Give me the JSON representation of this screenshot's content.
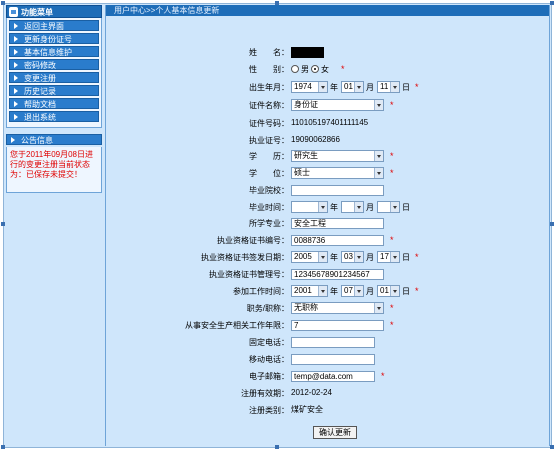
{
  "sidebar": {
    "title": "功能菜单",
    "items": [
      {
        "label": "返回主界面"
      },
      {
        "label": "更新身份证号"
      },
      {
        "label": "基本信息维护"
      },
      {
        "label": "密码修改"
      },
      {
        "label": "变更注册"
      },
      {
        "label": "历史记录"
      },
      {
        "label": "帮助文档"
      },
      {
        "label": "退出系统"
      }
    ],
    "notice_title": "公告信息",
    "notice_text": "您于2011年09月08日进行的变更注册当前状态为：已保存未提交！"
  },
  "main": {
    "breadcrumb": "用户中心>>个人基本信息更新"
  },
  "form": {
    "name_label": "姓　　名：",
    "gender_label": "性　　别：",
    "gender_male": "男",
    "gender_female": "女",
    "birth_label": "出生年月：",
    "birth_year": "1974",
    "birth_month": "01",
    "birth_day": "11",
    "unit_year": "年",
    "unit_month": "月",
    "unit_day": "日",
    "id_type_label": "证件名称：",
    "id_type_value": "身份证",
    "id_number_label": "证件号码：",
    "id_number_value": "110105197401111145",
    "license_label": "执业证号：",
    "license_value": "19090062866",
    "education_label": "学　　历：",
    "education_value": "研究生",
    "degree_label": "学　　位：",
    "degree_value": "硕士",
    "school_label": "毕业院校：",
    "school_value": "",
    "grad_label": "毕业时间：",
    "major_label": "所学专业：",
    "major_value": "安全工程",
    "cert_no_label": "执业资格证书编号：",
    "cert_no_value": "0088736",
    "cert_date_label": "执业资格证书签发日期：",
    "cert_year": "2005",
    "cert_month": "03",
    "cert_day": "17",
    "cert_mgmt_label": "执业资格证书管理号：",
    "cert_mgmt_value": "12345678901234567",
    "work_date_label": "参加工作时间：",
    "work_year": "2001",
    "work_month": "07",
    "work_day": "01",
    "title_label": "职务/职称：",
    "title_value": "无职称",
    "years_label": "从事安全生产相关工作年限：",
    "years_value": "7",
    "phone_label": "固定电话：",
    "phone_value": "",
    "mobile_label": "移动电话：",
    "mobile_value": "",
    "email_label": "电子邮箱：",
    "email_value": "temp@data.com",
    "expiry_label": "注册有效期：",
    "expiry_value": "2012-02-24",
    "category_label": "注册类别：",
    "category_value": "煤矿安全",
    "required_mark": "*",
    "submit_label": "确认更新"
  }
}
